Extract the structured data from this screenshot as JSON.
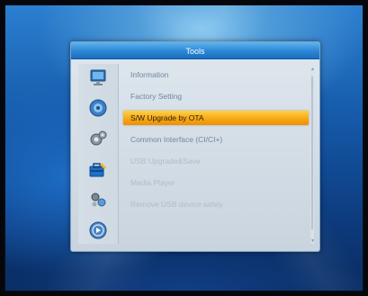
{
  "dialog": {
    "title": "Tools"
  },
  "sidebar": {
    "icons": [
      {
        "name": "monitor-icon"
      },
      {
        "name": "disc-icon"
      },
      {
        "name": "gear-icon"
      },
      {
        "name": "toolbox-icon"
      },
      {
        "name": "games-icon"
      },
      {
        "name": "media-icon"
      }
    ]
  },
  "menu": {
    "items": [
      {
        "label": "Information",
        "state": "enabled"
      },
      {
        "label": "Factory Setting",
        "state": "enabled"
      },
      {
        "label": "S/W Upgrade by OTA",
        "state": "selected"
      },
      {
        "label": "Common Interface (CI/CI+)",
        "state": "enabled"
      },
      {
        "label": "USB Upgrade&Save",
        "state": "disabled"
      },
      {
        "label": "Media Player",
        "state": "disabled"
      },
      {
        "label": "Remove USB device safely",
        "state": "disabled"
      }
    ]
  },
  "colors": {
    "highlight": "#f7a815",
    "title_bar": "#2b86d4",
    "background": "#1559a8"
  }
}
